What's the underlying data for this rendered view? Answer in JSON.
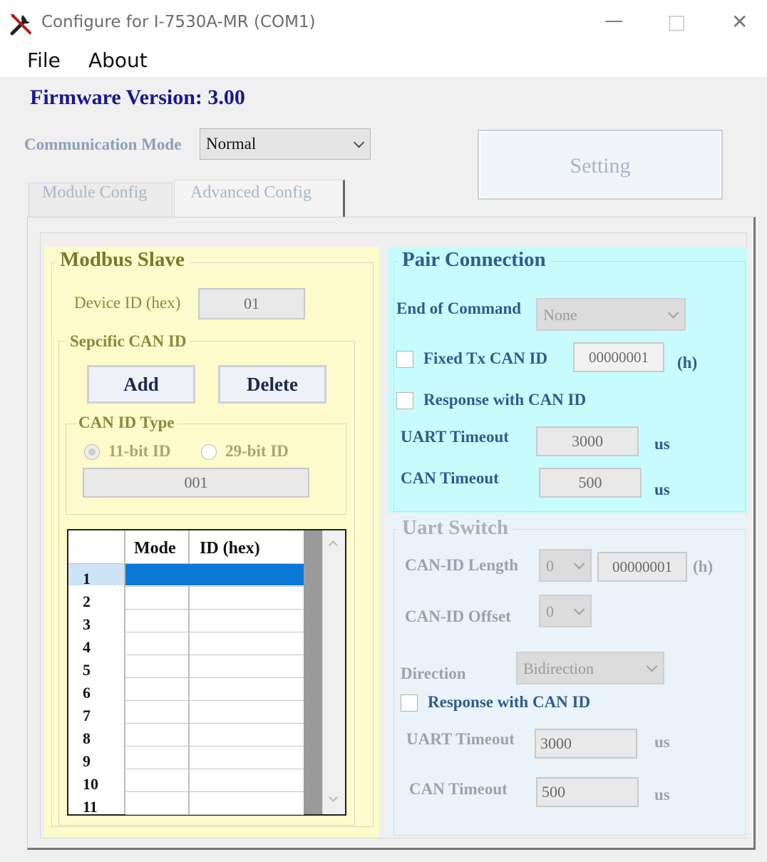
{
  "window": {
    "title": "Configure for I-7530A-MR (COM1)",
    "minimize": "—",
    "maximize": "□",
    "close": "✕"
  },
  "menu": {
    "file": "File",
    "about": "About"
  },
  "firmware": "Firmware Version: 3.00",
  "comm": {
    "label": "Communication Mode",
    "value": "Normal"
  },
  "setting_button": "Setting",
  "tabs": [
    "Module Config",
    "Advanced Config"
  ],
  "modbus": {
    "title": "Modbus Slave",
    "device_id_label": "Device ID (hex)",
    "device_id_value": "01",
    "specific_group": "Sepcific CAN ID",
    "add": "Add",
    "delete": "Delete",
    "can_id_type_group": "CAN ID Type",
    "radio_11": "11-bit ID",
    "radio_29": "29-bit ID",
    "can_id_value": "001",
    "table": {
      "headers": [
        "Mode",
        "ID (hex)"
      ],
      "rows": [
        "1",
        "2",
        "3",
        "4",
        "5",
        "6",
        "7",
        "8",
        "9",
        "10",
        "11"
      ]
    }
  },
  "pair": {
    "title": "Pair Connection",
    "eoc_label": "End of Command",
    "eoc_value": "None",
    "fixed_tx_label": "Fixed Tx CAN ID",
    "fixed_tx_value": "00000001",
    "fixed_tx_unit": "(h)",
    "resp_label": "Response with CAN ID",
    "uart_timeout_label": "UART Timeout",
    "uart_timeout_value": "3000",
    "uart_timeout_unit": "us",
    "can_timeout_label": "CAN Timeout",
    "can_timeout_value": "500",
    "can_timeout_unit": "us"
  },
  "uart_switch": {
    "title": "Uart Switch",
    "len_label": "CAN-ID Length",
    "len_value": "0",
    "len_id": "00000001",
    "len_unit": "(h)",
    "offset_label": "CAN-ID Offset",
    "offset_value": "0",
    "direction_label": "Direction",
    "direction_value": "Bidirection",
    "resp_label": "Response with CAN ID",
    "uart_timeout_label": "UART Timeout",
    "uart_timeout_value": "3000",
    "uart_timeout_unit": "us",
    "can_timeout_label": "CAN Timeout",
    "can_timeout_value": "500",
    "can_timeout_unit": "us"
  },
  "colors": {
    "modbus_bg": "#fdfbcb",
    "pair_bg": "#c8fcfc",
    "uart_bg": "#eaf3fa",
    "firmware": "#1a1a8c",
    "selected_row": "#0a78d7"
  }
}
